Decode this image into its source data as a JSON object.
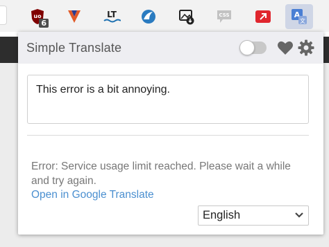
{
  "toolbar": {
    "extensions": [
      {
        "icon": "ublock-icon",
        "badge": "6"
      },
      {
        "icon": "vivaldi-v-icon"
      },
      {
        "icon": "languagetool-icon",
        "text": "LT"
      },
      {
        "icon": "shark-icon"
      },
      {
        "icon": "image-download-icon"
      },
      {
        "icon": "css-icon",
        "text": "CSS"
      },
      {
        "icon": "red-extension-icon"
      },
      {
        "icon": "simple-translate-icon",
        "active": true
      }
    ]
  },
  "popup": {
    "title": "Simple Translate",
    "source_text": "This error is a bit annoying.",
    "result_text": "Error: Service usage limit reached. Please wait a while and try again.",
    "link_label": "Open in Google Translate",
    "language": {
      "selected": "English"
    }
  },
  "colors": {
    "link": "#4a8fd0",
    "header_bg": "#eeeef2",
    "icon_gray": "#666666"
  }
}
